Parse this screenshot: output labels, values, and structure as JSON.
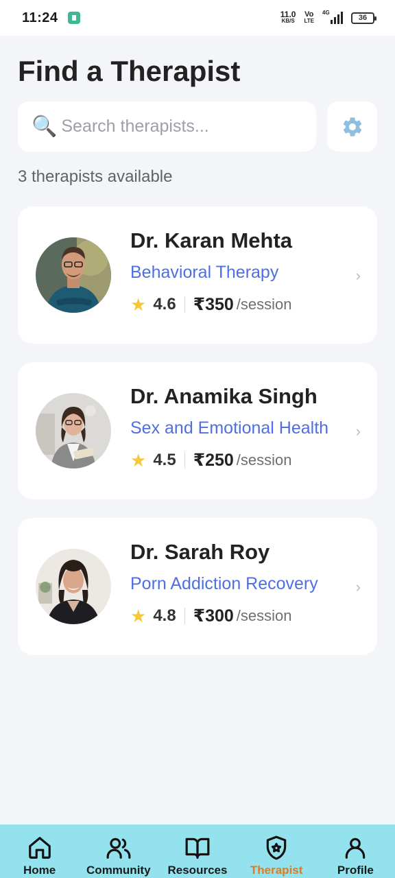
{
  "status_bar": {
    "time": "11:24",
    "net_speed_value": "11.0",
    "net_speed_unit": "KB/S",
    "volte_top": "Vo",
    "volte_bottom": "LTE",
    "network": "4G",
    "battery": "36"
  },
  "header": {
    "title": "Find a Therapist"
  },
  "search": {
    "placeholder": "Search therapists...",
    "value": ""
  },
  "results_text": "3 therapists available",
  "therapists": [
    {
      "name": "Dr. Karan Mehta",
      "specialty": "Behavioral Therapy",
      "rating": "4.6",
      "price": "₹350",
      "unit": "/session"
    },
    {
      "name": "Dr. Anamika Singh",
      "specialty": "Sex and Emotional Health",
      "rating": "4.5",
      "price": "₹250",
      "unit": "/session"
    },
    {
      "name": "Dr. Sarah Roy",
      "specialty": "Porn Addiction Recovery",
      "rating": "4.8",
      "price": "₹300",
      "unit": "/session"
    }
  ],
  "nav": {
    "items": [
      {
        "label": "Home",
        "icon": "home-icon"
      },
      {
        "label": "Community",
        "icon": "users-icon"
      },
      {
        "label": "Resources",
        "icon": "book-icon"
      },
      {
        "label": "Therapist",
        "icon": "shield-star-icon",
        "active": true
      },
      {
        "label": "Profile",
        "icon": "person-icon"
      }
    ]
  },
  "colors": {
    "accent": "#4f6fe0",
    "nav_background": "#93e2ee",
    "active_nav": "#e07b1f",
    "background": "#f3f5f9"
  }
}
